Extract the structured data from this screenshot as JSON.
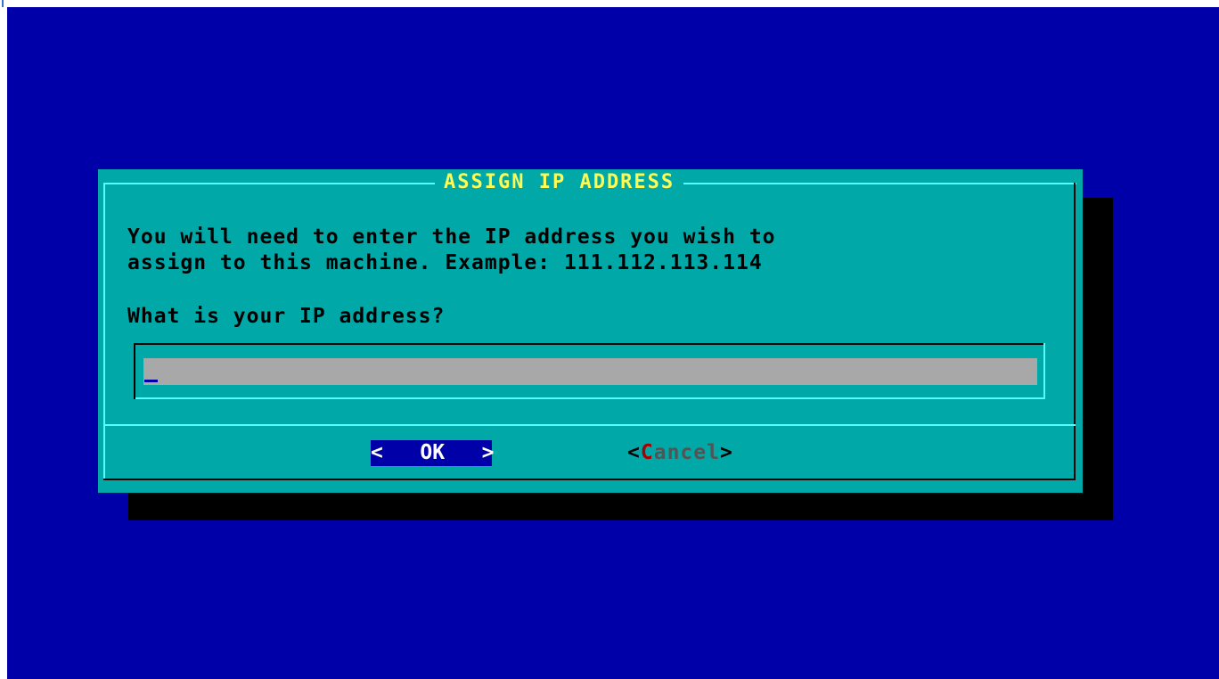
{
  "dialog": {
    "title": "ASSIGN IP ADDRESS",
    "message_line1": "You will need to enter the IP address you wish to",
    "message_line2": "assign to this machine. Example: 111.112.113.114",
    "question": "What is your IP address?",
    "input": {
      "value": "",
      "placeholder": ""
    },
    "buttons": {
      "ok": {
        "left_bracket": "<",
        "label": "OK",
        "right_bracket": ">"
      },
      "cancel": {
        "left_bracket": "<",
        "hotkey": "C",
        "label_rest": "ancel",
        "right_bracket": ">"
      }
    }
  },
  "colors": {
    "background": "#0000a8",
    "dialog": "#00a8a8",
    "title": "#fcfc54",
    "input_field": "#a8a8a8",
    "selected_button": "#0000a8",
    "hotkey": "#a80000"
  }
}
